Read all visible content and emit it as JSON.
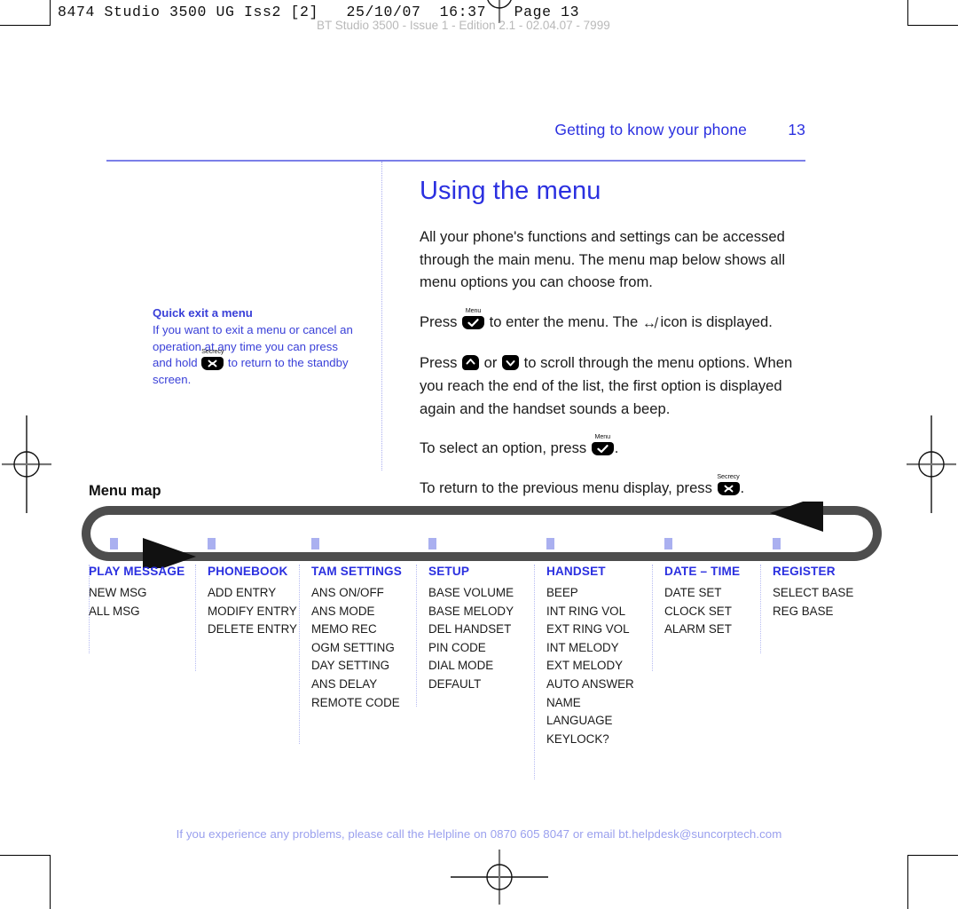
{
  "print_strip": {
    "line1": "8474 Studio 3500 UG Iss2 [2]   25/10/07  16:37   Page 13",
    "line2": "BT Studio 3500 - Issue 1 - Edition 2.1 - 02.04.07 - 7999"
  },
  "header": {
    "title": "Getting to know your phone",
    "page_number": "13"
  },
  "tip": {
    "title": "Quick exit a menu",
    "text_part1": "If you want to exit a menu or cancel an operation at any time you can press and hold ",
    "key_label": "Secrecy",
    "key_glyph": "x",
    "text_part2": " to return to the standby screen."
  },
  "main": {
    "title": "Using the menu",
    "para1": "All your phone's functions and settings can be accessed through the main menu. The menu map below shows all menu options you can choose from.",
    "para2_a": "Press ",
    "para2_key_label": "Menu",
    "para2_b": " to enter the menu. The ",
    "para2_icon": "↮",
    "para2_c": " icon is displayed.",
    "para3_a": "Press ",
    "para3_b": " or ",
    "para3_c": " to scroll through the menu options. When you reach the end of the list, the first option is displayed again and the handset sounds a beep.",
    "para4_a": "To select an option, press ",
    "para4_key_label": "Menu",
    "para4_b": ".",
    "para5_a": "To return to the previous menu display, press ",
    "para5_key_label": "Secrecy",
    "para5_b": "."
  },
  "menu_map": {
    "section_title": "Menu map",
    "columns": [
      {
        "head": "PLAY MESSAGE",
        "items": [
          "NEW MSG",
          "ALL MSG"
        ]
      },
      {
        "head": "PHONEBOOK",
        "items": [
          "ADD ENTRY",
          "MODIFY ENTRY",
          "DELETE ENTRY"
        ]
      },
      {
        "head": "TAM SETTINGS",
        "items": [
          "ANS ON/OFF",
          "ANS MODE",
          "MEMO REC",
          "OGM SETTING",
          "DAY SETTING",
          "ANS DELAY",
          "REMOTE CODE"
        ]
      },
      {
        "head": "SETUP",
        "items": [
          "BASE VOLUME",
          "BASE MELODY",
          "DEL HANDSET",
          "PIN CODE",
          "DIAL MODE",
          "DEFAULT"
        ]
      },
      {
        "head": "HANDSET",
        "items": [
          "BEEP",
          "INT RING VOL",
          "EXT RING VOL",
          "INT MELODY",
          "EXT MELODY",
          "AUTO ANSWER",
          "NAME",
          "LANGUAGE",
          "KEYLOCK?"
        ]
      },
      {
        "head": "DATE – TIME",
        "items": [
          "DATE SET",
          "CLOCK SET",
          "ALARM SET"
        ]
      },
      {
        "head": "REGISTER",
        "items": [
          "SELECT BASE",
          "REG BASE"
        ]
      }
    ]
  },
  "footer": {
    "text": "If you experience any problems, please call the Helpline on 0870 605 8047 or email bt.helpdesk@suncorptech.com"
  },
  "colors": {
    "accent_blue": "#2b30e0",
    "rule_blue": "#7b7fe8",
    "tip_blue": "#3a40d8",
    "footer_blue": "#9aa0ee",
    "tick_blue": "#aab0f0",
    "track_gray": "#4d4d4d",
    "text_black": "#1a1a1a"
  }
}
